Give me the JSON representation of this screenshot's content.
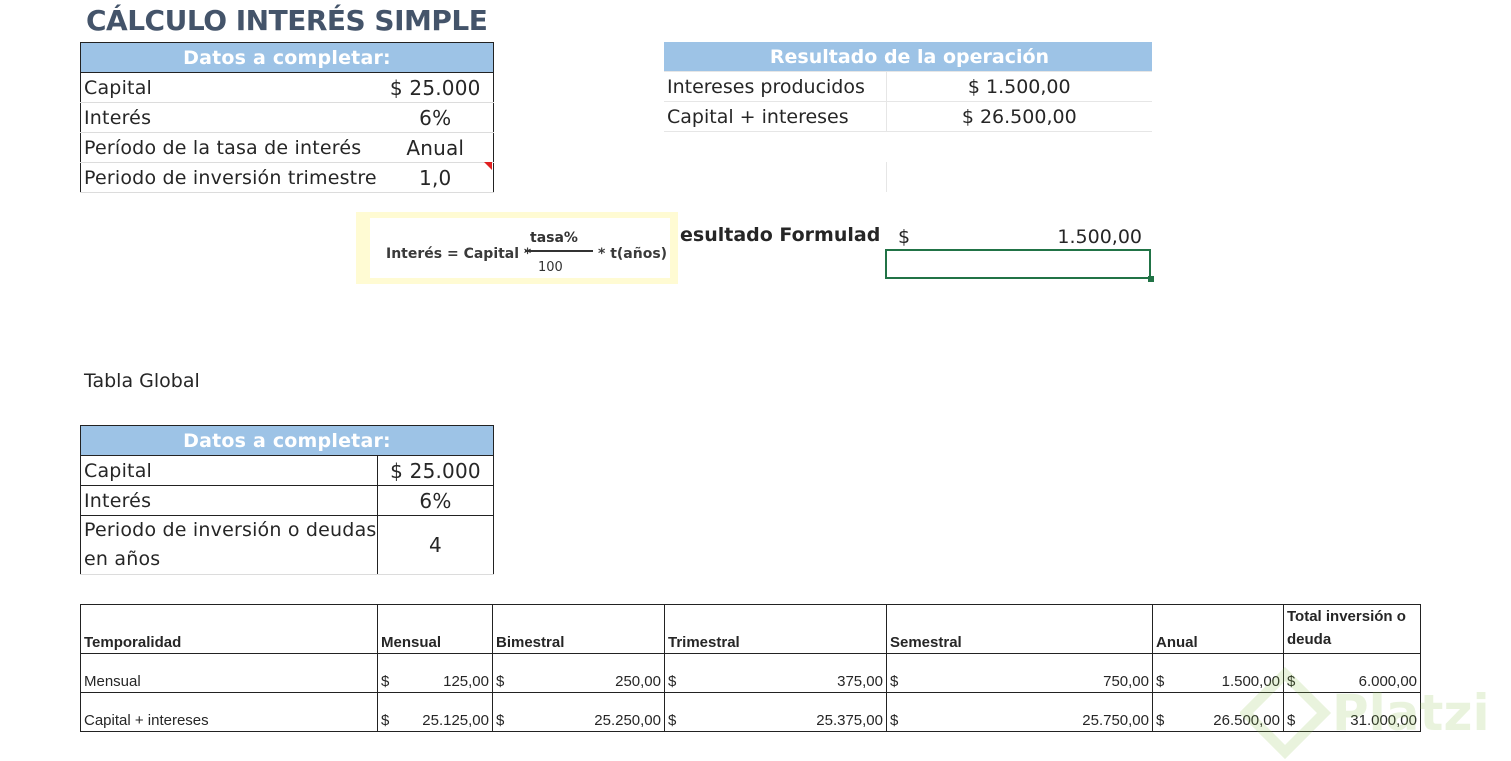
{
  "title": "CÁLCULO INTERÉS SIMPLE",
  "datos": {
    "header": "Datos a completar:",
    "rows": [
      {
        "label": "Capital",
        "value": "$ 25.000"
      },
      {
        "label": "Interés",
        "value": "6%"
      },
      {
        "label": "Período de la tasa de interés",
        "value": "Anual"
      },
      {
        "label": "Periodo de inversión trimestre",
        "value": "1,0"
      }
    ]
  },
  "resultado": {
    "header": "Resultado de la operación",
    "rows": [
      {
        "label": "Intereses producidos",
        "value": "$ 1.500,00"
      },
      {
        "label": "Capital + intereses",
        "value": "$ 26.500,00"
      }
    ]
  },
  "formula": {
    "lhs": "Interés = Capital *",
    "numerator": "tasa%",
    "denominator": "100",
    "rhs": "* t(años)"
  },
  "resultado_formulado": {
    "label": "esultado Formulado",
    "currency": "$",
    "value": "1.500,00"
  },
  "tabla_global_label": "Tabla Global",
  "datos2": {
    "header": "Datos a completar:",
    "rows": [
      {
        "label": "Capital",
        "value": "$ 25.000"
      },
      {
        "label": "Interés",
        "value": "6%"
      },
      {
        "label": "Periodo de inversión o deudas en años",
        "value": "4"
      }
    ]
  },
  "grid": {
    "headers": [
      "Temporalidad",
      "Mensual",
      "Bimestral",
      "Trimestral",
      "Semestral",
      "Anual",
      "Total inversión o deuda"
    ],
    "rows": [
      {
        "label": "Mensual",
        "currency": "$",
        "values": [
          "125,00",
          "250,00",
          "375,00",
          "750,00",
          "1.500,00",
          "6.000,00"
        ]
      },
      {
        "label": "Capital + intereses",
        "currency": "$",
        "values": [
          "25.125,00",
          "25.250,00",
          "25.375,00",
          "25.750,00",
          "26.500,00",
          "31.000,00"
        ]
      }
    ]
  },
  "watermark": "Platzi",
  "colors": {
    "header_fill": "#9dc3e6",
    "title": "#44546a",
    "selection": "#217346"
  }
}
